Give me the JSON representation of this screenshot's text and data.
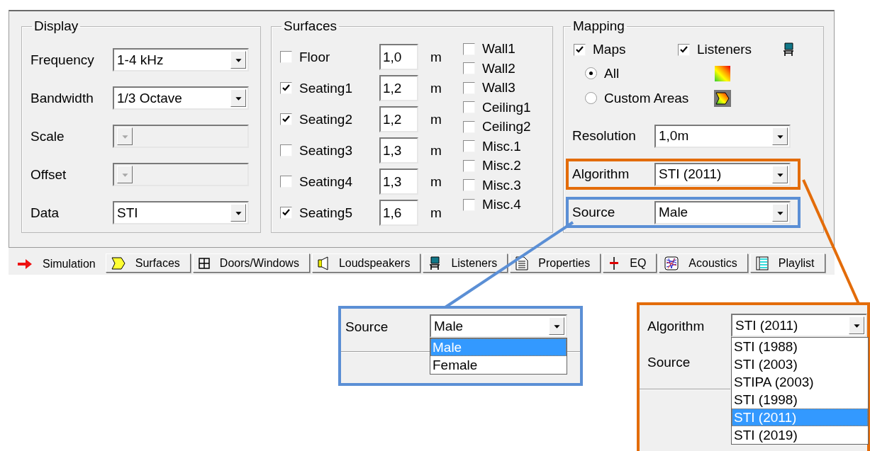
{
  "display": {
    "title": "Display",
    "fields": [
      {
        "label": "Frequency",
        "value": "1-4 kHz",
        "disabled": false
      },
      {
        "label": "Bandwidth",
        "value": "1/3 Octave",
        "disabled": false
      },
      {
        "label": "Scale",
        "disabled": true
      },
      {
        "label": "Offset",
        "disabled": true
      },
      {
        "label": "Data",
        "value": "STI",
        "disabled": false
      }
    ]
  },
  "surfaces": {
    "title": "Surfaces",
    "heights": [
      {
        "label": "Floor",
        "checked": false,
        "value": "1,0",
        "unit": "m"
      },
      {
        "label": "Seating1",
        "checked": true,
        "value": "1,2",
        "unit": "m"
      },
      {
        "label": "Seating2",
        "checked": true,
        "value": "1,2",
        "unit": "m"
      },
      {
        "label": "Seating3",
        "checked": false,
        "value": "1,3",
        "unit": "m"
      },
      {
        "label": "Seating4",
        "checked": false,
        "value": "1,3",
        "unit": "m"
      },
      {
        "label": "Seating5",
        "checked": true,
        "value": "1,6",
        "unit": "m"
      }
    ],
    "others": [
      {
        "label": "Wall1",
        "checked": false
      },
      {
        "label": "Wall2",
        "checked": false
      },
      {
        "label": "Wall3",
        "checked": false
      },
      {
        "label": "Ceiling1",
        "checked": false
      },
      {
        "label": "Ceiling2",
        "checked": false
      },
      {
        "label": "Misc.1",
        "checked": false
      },
      {
        "label": "Misc.2",
        "checked": false
      },
      {
        "label": "Misc.3",
        "checked": false
      },
      {
        "label": "Misc.4",
        "checked": false
      }
    ]
  },
  "mapping": {
    "title": "Mapping",
    "maps": {
      "label": "Maps",
      "checked": true
    },
    "listeners": {
      "label": "Listeners",
      "checked": true
    },
    "areas": [
      {
        "label": "All",
        "selected": true
      },
      {
        "label": "Custom Areas",
        "selected": false
      }
    ],
    "combos": [
      {
        "label": "Resolution",
        "value": "1,0m"
      },
      {
        "label": "Algorithm",
        "value": "STI (2011)",
        "color": "#e36c0a"
      },
      {
        "label": "Source",
        "value": "Male",
        "color": "#5b8fd5"
      }
    ]
  },
  "tabs": [
    {
      "label": "Simulation",
      "selected": true
    },
    {
      "label": "Surfaces",
      "selected": false
    },
    {
      "label": "Doors/Windows",
      "selected": false
    },
    {
      "label": "Loudspeakers",
      "selected": false
    },
    {
      "label": "Listeners",
      "selected": false
    },
    {
      "label": "Properties",
      "selected": false
    },
    {
      "label": "EQ",
      "selected": false
    },
    {
      "label": "Acoustics",
      "selected": false
    },
    {
      "label": "Playlist",
      "selected": false
    }
  ],
  "callouts": [
    {
      "kind": "source",
      "color": "#5b8fd5",
      "label": "Source",
      "value": "Male",
      "options": [
        {
          "label": "Male",
          "selected": true
        },
        {
          "label": "Female",
          "selected": false
        }
      ]
    },
    {
      "kind": "algorithm",
      "color": "#e36c0a",
      "label": "Algorithm",
      "value": "STI (2011)",
      "below_label": "Source",
      "options": [
        {
          "label": "STI (1988)",
          "selected": false
        },
        {
          "label": "STI (2003)",
          "selected": false
        },
        {
          "label": "STIPA (2003)",
          "selected": false
        },
        {
          "label": "STI (1998)",
          "selected": false
        },
        {
          "label": "STI (2011)",
          "selected": true
        },
        {
          "label": "STI (2019)",
          "selected": false
        }
      ]
    }
  ]
}
